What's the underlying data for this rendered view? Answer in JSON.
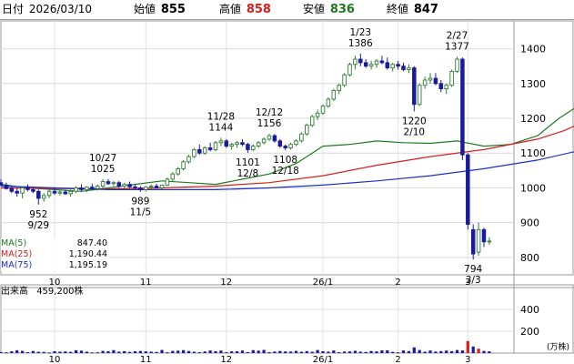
{
  "header": {
    "date_label": "日付",
    "date": "2026/03/10",
    "open_label": "始値",
    "open": "855",
    "high_label": "高値",
    "high": "858",
    "low_label": "安値",
    "low": "836",
    "close_label": "終値",
    "close": "847"
  },
  "colors": {
    "up": "#2e7d32",
    "down": "#1a1a9c",
    "ma5": "#1f7a1f",
    "ma25": "#d42020",
    "ma75": "#1a2fcf",
    "high_value": "#d42020",
    "low_value": "#1f7a1f",
    "volume": "#1a1a9c",
    "volume_up": "#d42020"
  },
  "legend": [
    {
      "label": "MA(5)",
      "value": "847.40",
      "color": "#1f7a1f"
    },
    {
      "label": "MA(25)",
      "value": "1,190.44",
      "color": "#d42020"
    },
    {
      "label": "MA(75)",
      "value": "1,195.19",
      "color": "#1a2fcf"
    }
  ],
  "volume_caption": {
    "label": "出来高",
    "value": "459,200株"
  },
  "volume_unit": "(万株)",
  "chart_data": [
    {
      "type": "candlestick",
      "title": "",
      "x": {
        "labels": [
          "10",
          "11",
          "12",
          "26/1",
          "2",
          "3"
        ]
      },
      "y": {
        "ticks": [
          800,
          900,
          1000,
          1100,
          1200,
          1300,
          1400
        ],
        "range": [
          750,
          1480
        ]
      },
      "grid": true,
      "annotations": [
        {
          "kind": "high",
          "value": "1386",
          "date": "1/23"
        },
        {
          "kind": "high",
          "value": "1377",
          "date": "2/27"
        },
        {
          "kind": "high",
          "value": "1025",
          "date": "10/27"
        },
        {
          "kind": "high",
          "value": "1144",
          "date": "11/28"
        },
        {
          "kind": "high",
          "value": "1156",
          "date": "12/12"
        },
        {
          "kind": "low",
          "value": "952",
          "date": "9/29"
        },
        {
          "kind": "low",
          "value": "989",
          "date": "11/5"
        },
        {
          "kind": "low",
          "value": "1101",
          "date": "12/8"
        },
        {
          "kind": "low",
          "value": "1108",
          "date": "12/18"
        },
        {
          "kind": "low",
          "value": "1220",
          "date": "2/10"
        },
        {
          "kind": "low",
          "value": "794",
          "date": "3/3"
        }
      ],
      "moving_averages": [
        {
          "name": "MA(5)",
          "points": [
            [
              0,
              1010
            ],
            [
              5,
              1000
            ],
            [
              10,
              995
            ],
            [
              15,
              990
            ],
            [
              20,
              1000
            ],
            [
              25,
              1010
            ],
            [
              30,
              1020
            ],
            [
              35,
              1015
            ],
            [
              40,
              1010
            ],
            [
              45,
              1025
            ],
            [
              50,
              1040
            ],
            [
              55,
              1070
            ],
            [
              60,
              1120
            ],
            [
              65,
              1125
            ],
            [
              70,
              1135
            ],
            [
              75,
              1130
            ],
            [
              80,
              1128
            ],
            [
              85,
              1135
            ],
            [
              90,
              1120
            ],
            [
              95,
              1125
            ],
            [
              100,
              1150
            ],
            [
              104,
              1200
            ],
            [
              107,
              1230
            ],
            [
              110,
              1255
            ],
            [
              113,
              1295
            ],
            [
              115,
              1330
            ],
            [
              117,
              1355
            ],
            [
              120,
              1355
            ],
            [
              123,
              1350
            ],
            [
              127,
              1345
            ],
            [
              130,
              1340
            ],
            [
              133,
              1320
            ],
            [
              135,
              1305
            ],
            [
              137,
              1295
            ],
            [
              140,
              1300
            ],
            [
              142,
              1310
            ],
            [
              143,
              1315
            ],
            [
              145,
              1090
            ],
            [
              147,
              900
            ],
            [
              150,
              860
            ],
            [
              152,
              847
            ]
          ]
        },
        {
          "name": "MA(25)",
          "points": [
            [
              0,
              1000
            ],
            [
              10,
              998
            ],
            [
              20,
              997
            ],
            [
              30,
              1000
            ],
            [
              40,
              1005
            ],
            [
              50,
              1015
            ],
            [
              60,
              1035
            ],
            [
              70,
              1065
            ],
            [
              80,
              1090
            ],
            [
              90,
              1110
            ],
            [
              100,
              1140
            ],
            [
              105,
              1165
            ],
            [
              110,
              1200
            ],
            [
              115,
              1240
            ],
            [
              120,
              1275
            ],
            [
              125,
              1300
            ],
            [
              130,
              1320
            ],
            [
              135,
              1325
            ],
            [
              140,
              1320
            ],
            [
              143,
              1300
            ],
            [
              147,
              1260
            ],
            [
              152,
              1190
            ]
          ]
        },
        {
          "name": "MA(75)",
          "points": [
            [
              0,
              1005
            ],
            [
              20,
              995
            ],
            [
              40,
              995
            ],
            [
              50,
              1000
            ],
            [
              60,
              1008
            ],
            [
              70,
              1020
            ],
            [
              80,
              1035
            ],
            [
              90,
              1055
            ],
            [
              100,
              1080
            ],
            [
              110,
              1115
            ],
            [
              120,
              1160
            ],
            [
              130,
              1190
            ],
            [
              140,
              1210
            ],
            [
              143,
              1215
            ],
            [
              147,
              1205
            ],
            [
              152,
              1195
            ]
          ]
        }
      ],
      "price_series": [
        [
          0,
          1015,
          1025,
          1005,
          1008
        ],
        [
          1,
          1008,
          1015,
          995,
          998
        ],
        [
          2,
          998,
          1005,
          985,
          990
        ],
        [
          3,
          990,
          1000,
          975,
          985
        ],
        [
          4,
          985,
          1005,
          970,
          1000
        ],
        [
          5,
          1000,
          1010,
          990,
          995
        ],
        [
          6,
          995,
          1000,
          985,
          990
        ],
        [
          7,
          990,
          995,
          952,
          970
        ],
        [
          8,
          970,
          985,
          960,
          978
        ],
        [
          9,
          978,
          995,
          970,
          990
        ],
        [
          10,
          990,
          1000,
          980,
          985
        ],
        [
          11,
          985,
          992,
          978,
          988
        ],
        [
          12,
          988,
          995,
          980,
          983
        ],
        [
          13,
          983,
          995,
          975,
          990
        ],
        [
          14,
          990,
          1005,
          985,
          1000
        ],
        [
          15,
          1000,
          1010,
          990,
          995
        ],
        [
          16,
          995,
          1005,
          988,
          1002
        ],
        [
          17,
          1002,
          1012,
          995,
          998
        ],
        [
          18,
          998,
          1010,
          992,
          1005
        ],
        [
          19,
          1005,
          1025,
          1000,
          1018
        ],
        [
          20,
          1018,
          1025,
          1008,
          1012
        ],
        [
          21,
          1012,
          1020,
          1005,
          1015
        ],
        [
          22,
          1015,
          1020,
          1000,
          1005
        ],
        [
          23,
          1005,
          1015,
          998,
          1010
        ],
        [
          24,
          1010,
          1018,
          1000,
          1003
        ],
        [
          25,
          1003,
          1008,
          995,
          1000
        ],
        [
          26,
          1000,
          1005,
          989,
          995
        ],
        [
          27,
          995,
          1005,
          990,
          1002
        ],
        [
          28,
          1002,
          1010,
          995,
          1005
        ],
        [
          29,
          1005,
          1012,
          998,
          1000
        ],
        [
          30,
          1000,
          1010,
          995,
          1008
        ],
        [
          31,
          1008,
          1030,
          1005,
          1025
        ],
        [
          32,
          1025,
          1045,
          1020,
          1040
        ],
        [
          33,
          1040,
          1060,
          1035,
          1055
        ],
        [
          34,
          1055,
          1080,
          1050,
          1075
        ],
        [
          35,
          1075,
          1095,
          1070,
          1090
        ],
        [
          36,
          1090,
          1115,
          1085,
          1110
        ],
        [
          37,
          1110,
          1125,
          1095,
          1100
        ],
        [
          38,
          1100,
          1120,
          1095,
          1115
        ],
        [
          39,
          1115,
          1130,
          1105,
          1110
        ],
        [
          40,
          1110,
          1135,
          1105,
          1130
        ],
        [
          41,
          1130,
          1144,
          1120,
          1135
        ],
        [
          42,
          1135,
          1140,
          1115,
          1120
        ],
        [
          43,
          1120,
          1130,
          1110,
          1125
        ],
        [
          44,
          1125,
          1135,
          1115,
          1130
        ],
        [
          45,
          1130,
          1140,
          1120,
          1125
        ],
        [
          46,
          1125,
          1130,
          1101,
          1110
        ],
        [
          47,
          1110,
          1125,
          1105,
          1120
        ],
        [
          48,
          1120,
          1135,
          1115,
          1130
        ],
        [
          49,
          1130,
          1145,
          1125,
          1140
        ],
        [
          50,
          1140,
          1156,
          1135,
          1150
        ],
        [
          51,
          1150,
          1155,
          1130,
          1135
        ],
        [
          52,
          1135,
          1140,
          1115,
          1120
        ],
        [
          53,
          1120,
          1125,
          1108,
          1115
        ],
        [
          54,
          1115,
          1130,
          1110,
          1125
        ],
        [
          55,
          1125,
          1140,
          1120,
          1135
        ],
        [
          56,
          1135,
          1160,
          1130,
          1155
        ],
        [
          57,
          1155,
          1185,
          1150,
          1180
        ],
        [
          58,
          1180,
          1210,
          1175,
          1205
        ],
        [
          59,
          1205,
          1225,
          1195,
          1215
        ],
        [
          60,
          1215,
          1240,
          1210,
          1235
        ],
        [
          61,
          1235,
          1260,
          1230,
          1255
        ],
        [
          62,
          1255,
          1285,
          1250,
          1280
        ],
        [
          63,
          1280,
          1300,
          1270,
          1295
        ],
        [
          64,
          1295,
          1330,
          1290,
          1325
        ],
        [
          65,
          1325,
          1360,
          1320,
          1355
        ],
        [
          66,
          1355,
          1380,
          1340,
          1370
        ],
        [
          67,
          1370,
          1386,
          1350,
          1360
        ],
        [
          68,
          1360,
          1370,
          1345,
          1350
        ],
        [
          69,
          1350,
          1365,
          1340,
          1355
        ],
        [
          70,
          1355,
          1370,
          1345,
          1365
        ],
        [
          71,
          1365,
          1380,
          1355,
          1360
        ],
        [
          72,
          1360,
          1375,
          1340,
          1345
        ],
        [
          73,
          1345,
          1360,
          1335,
          1355
        ],
        [
          74,
          1355,
          1365,
          1340,
          1350
        ],
        [
          75,
          1350,
          1360,
          1335,
          1340
        ],
        [
          76,
          1340,
          1355,
          1330,
          1345
        ],
        [
          77,
          1345,
          1350,
          1220,
          1240
        ],
        [
          78,
          1240,
          1300,
          1235,
          1295
        ],
        [
          79,
          1295,
          1320,
          1285,
          1310
        ],
        [
          80,
          1310,
          1330,
          1300,
          1315
        ],
        [
          81,
          1315,
          1330,
          1295,
          1300
        ],
        [
          82,
          1300,
          1310,
          1275,
          1285
        ],
        [
          83,
          1285,
          1300,
          1270,
          1295
        ],
        [
          84,
          1295,
          1340,
          1290,
          1335
        ],
        [
          85,
          1335,
          1377,
          1330,
          1370
        ],
        [
          86,
          1370,
          1375,
          1080,
          1095
        ],
        [
          87,
          1095,
          1100,
          880,
          895
        ],
        [
          88,
          880,
          895,
          794,
          810
        ],
        [
          89,
          815,
          900,
          805,
          880
        ],
        [
          90,
          880,
          885,
          830,
          845
        ],
        [
          91,
          845,
          858,
          836,
          847
        ]
      ]
    },
    {
      "type": "bar",
      "title": "",
      "series": [
        {
          "values": [
            10,
            7,
            16,
            26,
            20,
            8,
            19,
            12,
            11,
            5,
            17,
            13,
            15,
            11,
            26,
            22,
            13,
            6,
            7,
            20,
            17,
            27,
            13,
            18,
            11,
            17,
            19,
            16,
            13,
            10,
            29,
            7,
            20,
            22,
            27,
            19,
            12,
            8,
            15,
            24,
            17,
            23,
            8,
            16,
            17,
            23,
            9,
            27,
            22,
            29,
            8,
            14,
            19,
            15,
            14,
            20,
            12,
            18,
            12,
            28,
            17,
            13,
            24,
            8,
            14,
            15,
            21,
            13,
            10,
            19,
            16,
            25,
            25,
            11,
            7,
            24,
            18,
            52,
            28,
            13,
            24,
            14,
            18,
            23,
            17,
            28,
            24,
            110,
            60,
            40,
            20,
            16
          ]
        }
      ]
    }
  ]
}
